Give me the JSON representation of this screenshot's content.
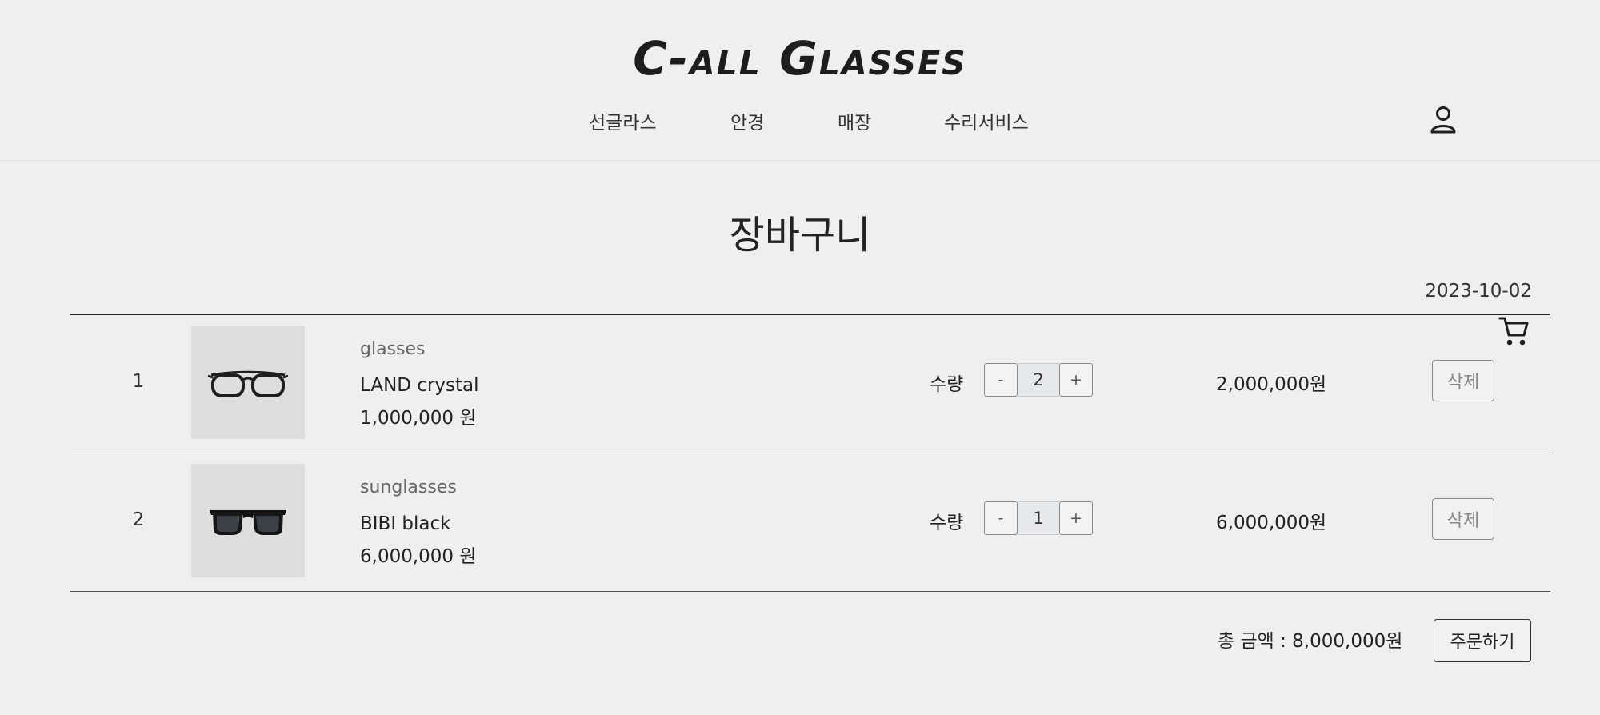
{
  "header": {
    "logo": "C-all Glasses",
    "nav": [
      {
        "label": "선글라스"
      },
      {
        "label": "안경"
      },
      {
        "label": "매장"
      },
      {
        "label": "수리서비스"
      }
    ],
    "icons": [
      "user-icon",
      "cart-icon"
    ]
  },
  "page": {
    "title": "장바구니",
    "date": "2023-10-02"
  },
  "cart": {
    "items": [
      {
        "index": "1",
        "category": "glasses",
        "name": "LAND crystal",
        "price": "1,000,000 원",
        "qty_label": "수량",
        "qty": "2",
        "minus": "-",
        "plus": "+",
        "line_total": "2,000,000원",
        "delete_label": "삭제",
        "image": "clear-frame-glasses"
      },
      {
        "index": "2",
        "category": "sunglasses",
        "name": "BIBI black",
        "price": "6,000,000 원",
        "qty_label": "수량",
        "qty": "1",
        "minus": "-",
        "plus": "+",
        "line_total": "6,000,000원",
        "delete_label": "삭제",
        "image": "black-sunglasses"
      }
    ]
  },
  "summary": {
    "total": "총 금액 : 8,000,000원",
    "order_label": "주문하기"
  }
}
